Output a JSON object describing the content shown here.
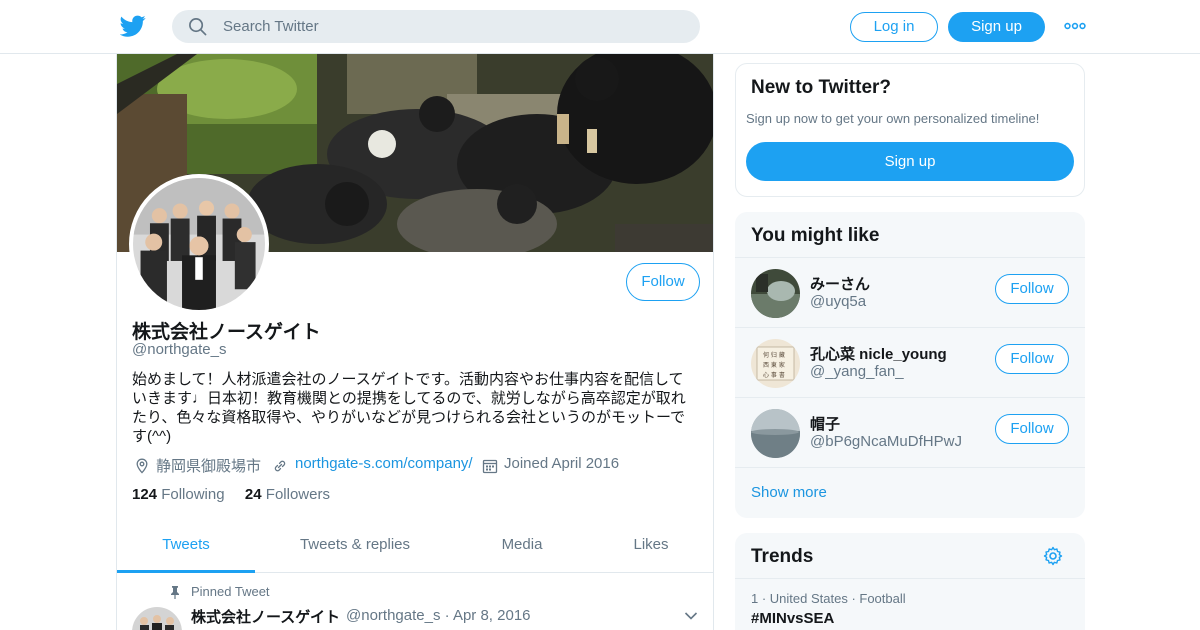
{
  "header": {
    "search_placeholder": "Search Twitter",
    "login_label": "Log in",
    "signup_label": "Sign up"
  },
  "profile": {
    "follow_label": "Follow",
    "name": "株式会社ノースゲイト",
    "handle": "@northgate_s",
    "bio": "始めまして！人材派遣会社のノースゲイトです。活動内容やお仕事内容を配信していきます♩日本初！教育機関との提携をしてるので、就労しながら高卒認定が取れたり、色々な資格取得や、やりがいなどが見つけられる会社というのがモットーです(^^)",
    "location": "静岡県御殿場市",
    "website": "northgate-s.com/company/",
    "joined": "Joined April 2016",
    "following_count": "124",
    "following_label": "Following",
    "followers_count": "24",
    "followers_label": "Followers"
  },
  "tabs": [
    "Tweets",
    "Tweets & replies",
    "Media",
    "Likes"
  ],
  "pinned": {
    "label": "Pinned Tweet",
    "name": "株式会社ノースゲイト",
    "meta": "@northgate_s · Apr 8, 2016"
  },
  "new_to_twitter": {
    "title": "New to Twitter?",
    "subtitle": "Sign up now to get your own personalized timeline!",
    "button": "Sign up"
  },
  "you_might_like": {
    "title": "You might like",
    "items": [
      {
        "name": "みーさん",
        "handle": "@uyq5a",
        "follow": "Follow"
      },
      {
        "name": "孔心菜 nicle_young",
        "handle": "@_yang_fan_",
        "follow": "Follow"
      },
      {
        "name": "帽子",
        "handle": "@bP6gNcaMuDfHPwJ",
        "follow": "Follow"
      }
    ],
    "show_more": "Show more"
  },
  "trends": {
    "title": "Trends",
    "items": [
      {
        "context": "1 · United States · Football",
        "tag": "#MINvsSEA"
      }
    ]
  },
  "colors": {
    "accent": "#1da1f2",
    "link": "#1b95e0",
    "text": "#14171a",
    "muted": "#657786",
    "panel": "#f5f8fa"
  },
  "icons": [
    "twitter-bird-icon",
    "search-icon",
    "more-dots-icon",
    "location-icon",
    "link-icon",
    "calendar-icon",
    "pin-icon",
    "chevron-down-icon",
    "gear-icon"
  ]
}
